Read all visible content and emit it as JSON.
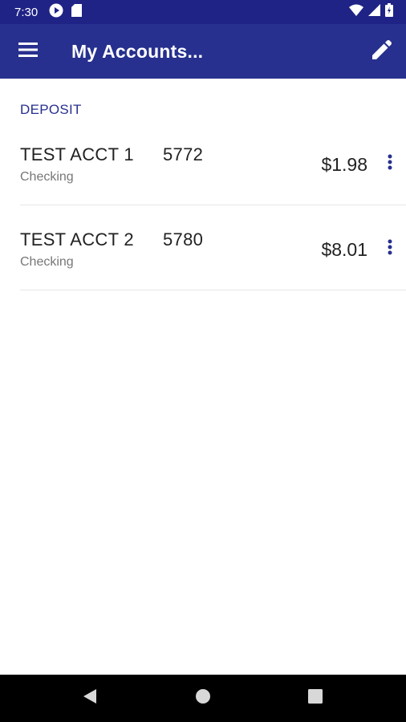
{
  "status_bar": {
    "time": "7:30",
    "icons_left": [
      "play-circle-icon",
      "sd-card-icon"
    ],
    "icons_right": [
      "wifi-icon",
      "cell-signal-icon",
      "battery-icon"
    ]
  },
  "app_bar": {
    "title": "My Accounts...",
    "menu_icon": "hamburger-menu-icon",
    "edit_icon": "pencil-icon"
  },
  "section": {
    "title": "DEPOSIT"
  },
  "accounts": [
    {
      "name": "TEST ACCT 1",
      "number": "5772",
      "type": "Checking",
      "balance": "$1.98"
    },
    {
      "name": "TEST ACCT 2",
      "number": "5780",
      "type": "Checking",
      "balance": "$8.01"
    }
  ],
  "nav_bar": {
    "buttons": [
      "back-triangle-icon",
      "home-circle-icon",
      "recents-square-icon"
    ]
  },
  "colors": {
    "status_bar": "#1f2385",
    "app_bar": "#27308e",
    "accent": "#27308e",
    "text_primary": "#222222",
    "text_secondary": "#777777"
  }
}
